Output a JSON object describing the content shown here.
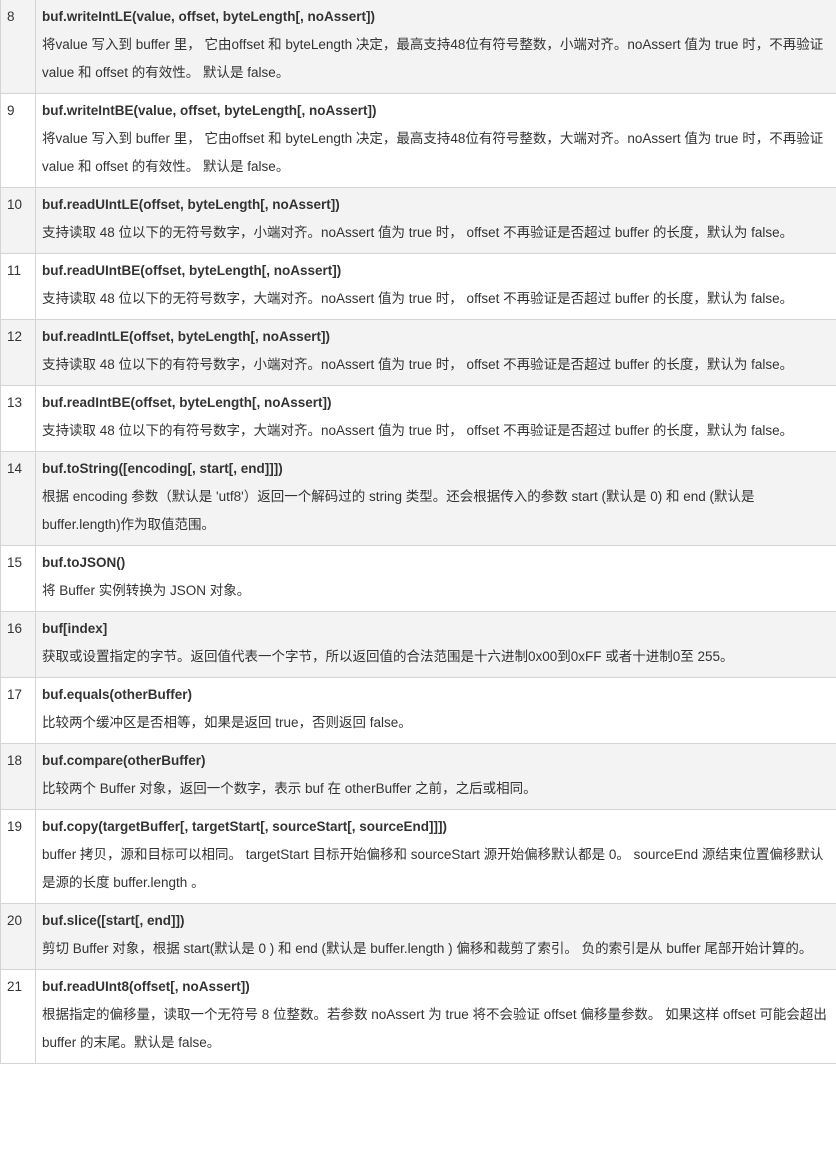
{
  "rows": [
    {
      "num": "8",
      "method": "buf.writeIntLE(value, offset, byteLength[, noAssert])",
      "desc": "将value 写入到 buffer 里， 它由offset 和 byteLength 决定，最高支持48位有符号整数，小端对齐。noAssert 值为 true 时，不再验证 value 和 offset 的有效性。 默认是 false。"
    },
    {
      "num": "9",
      "method": "buf.writeIntBE(value, offset, byteLength[, noAssert])",
      "desc": "将value 写入到 buffer 里， 它由offset 和 byteLength 决定，最高支持48位有符号整数，大端对齐。noAssert 值为 true 时，不再验证 value 和 offset 的有效性。 默认是 false。"
    },
    {
      "num": "10",
      "method": "buf.readUIntLE(offset, byteLength[, noAssert])",
      "desc": "支持读取 48 位以下的无符号数字，小端对齐。noAssert 值为 true 时， offset 不再验证是否超过 buffer 的长度，默认为 false。"
    },
    {
      "num": "11",
      "method": "buf.readUIntBE(offset, byteLength[, noAssert])",
      "desc": "支持读取 48 位以下的无符号数字，大端对齐。noAssert 值为 true 时， offset 不再验证是否超过 buffer 的长度，默认为 false。"
    },
    {
      "num": "12",
      "method": "buf.readIntLE(offset, byteLength[, noAssert])",
      "desc": "支持读取 48 位以下的有符号数字，小端对齐。noAssert 值为 true 时， offset 不再验证是否超过 buffer 的长度，默认为 false。"
    },
    {
      "num": "13",
      "method": "buf.readIntBE(offset, byteLength[, noAssert])",
      "desc": "支持读取 48 位以下的有符号数字，大端对齐。noAssert 值为 true 时， offset 不再验证是否超过 buffer 的长度，默认为 false。"
    },
    {
      "num": "14",
      "method": "buf.toString([encoding[, start[, end]]])",
      "desc": "根据 encoding 参数（默认是 'utf8'）返回一个解码过的 string 类型。还会根据传入的参数 start (默认是 0) 和 end (默认是 buffer.length)作为取值范围。"
    },
    {
      "num": "15",
      "method": "buf.toJSON()",
      "desc": "将 Buffer 实例转换为 JSON 对象。"
    },
    {
      "num": "16",
      "method": "buf[index]",
      "desc": "获取或设置指定的字节。返回值代表一个字节，所以返回值的合法范围是十六进制0x00到0xFF 或者十进制0至 255。"
    },
    {
      "num": "17",
      "method": "buf.equals(otherBuffer)",
      "desc": "比较两个缓冲区是否相等，如果是返回 true，否则返回 false。"
    },
    {
      "num": "18",
      "method": "buf.compare(otherBuffer)",
      "desc": "比较两个 Buffer 对象，返回一个数字，表示 buf 在 otherBuffer 之前，之后或相同。"
    },
    {
      "num": "19",
      "method": "buf.copy(targetBuffer[, targetStart[, sourceStart[, sourceEnd]]])",
      "desc": "buffer 拷贝，源和目标可以相同。 targetStart 目标开始偏移和 sourceStart 源开始偏移默认都是 0。 sourceEnd 源结束位置偏移默认是源的长度 buffer.length 。"
    },
    {
      "num": "20",
      "method": "buf.slice([start[, end]])",
      "desc": "剪切 Buffer 对象，根据 start(默认是 0 ) 和 end (默认是 buffer.length ) 偏移和裁剪了索引。 负的索引是从 buffer 尾部开始计算的。"
    },
    {
      "num": "21",
      "method": "buf.readUInt8(offset[, noAssert])",
      "desc": "根据指定的偏移量，读取一个无符号 8 位整数。若参数 noAssert 为 true 将不会验证 offset 偏移量参数。 如果这样 offset 可能会超出buffer 的末尾。默认是 false。"
    }
  ]
}
